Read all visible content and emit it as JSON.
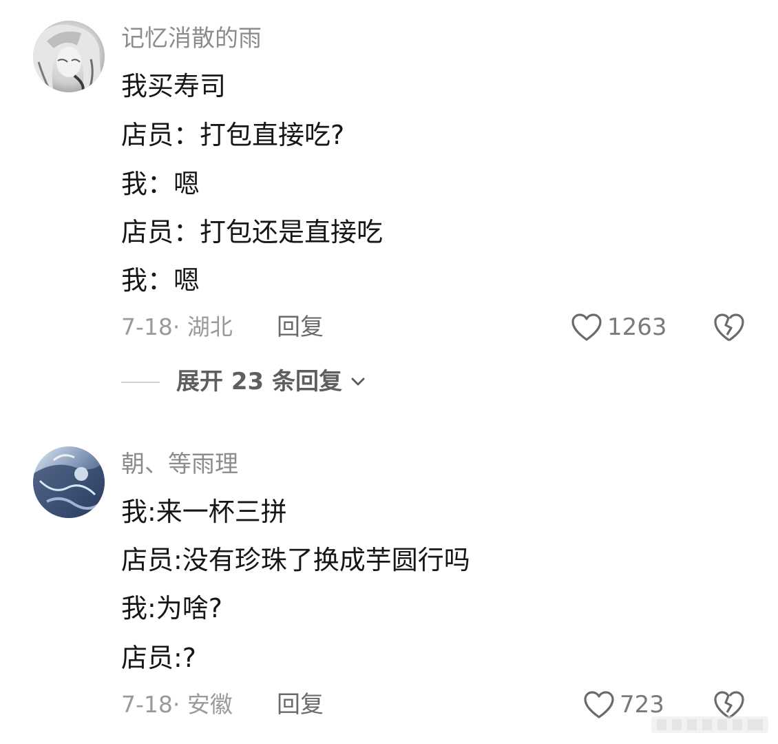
{
  "comments": [
    {
      "username": "记忆消散的雨",
      "lines": [
        "我买寿司",
        "店员：打包直接吃?",
        "我：嗯",
        "店员：打包还是直接吃",
        "我：嗯"
      ],
      "date_location": "7-18· 湖北",
      "reply_label": "回复",
      "like_count": "1263",
      "avatar_icon": "anime-girl-avatar-grayscale"
    },
    {
      "username": "朝、等雨理",
      "lines": [
        "我:来一杯三拼",
        "店员:没有珍珠了换成芋圆行吗",
        "我:为啥?",
        "店员:?"
      ],
      "date_location": "7-18· 安徽",
      "reply_label": "回复",
      "like_count": "723",
      "avatar_icon": "anime-scene-avatar-blue"
    }
  ],
  "expand_replies": {
    "label": "展开 23 条回复"
  },
  "icons": {
    "like": "heart-outline-icon",
    "dislike": "broken-heart-icon",
    "expand": "chevron-down-icon"
  },
  "colors": {
    "username": "#8c8c8c",
    "body": "#161616",
    "meta": "#9a9a9a"
  }
}
